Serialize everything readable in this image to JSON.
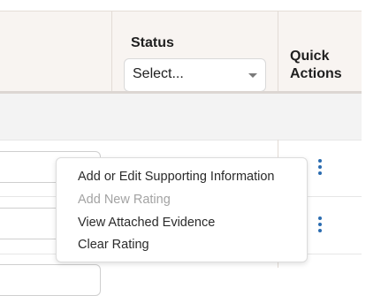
{
  "header": {
    "status_title": "Status",
    "status_select_value": "Select...",
    "quick_actions_title": "Quick Actions"
  },
  "context_menu": {
    "items": [
      {
        "label": "Add or Edit Supporting Information",
        "enabled": true
      },
      {
        "label": "Add New Rating",
        "enabled": false
      },
      {
        "label": "View Attached Evidence",
        "enabled": true
      },
      {
        "label": "Clear Rating",
        "enabled": true
      }
    ]
  },
  "icons": {
    "kebab": "vertical-ellipsis",
    "caret": "chevron-down"
  },
  "colors": {
    "header_bg": "#f8f4f1",
    "accent": "#2b6cb0",
    "disabled_text": "#a3a3a3"
  }
}
